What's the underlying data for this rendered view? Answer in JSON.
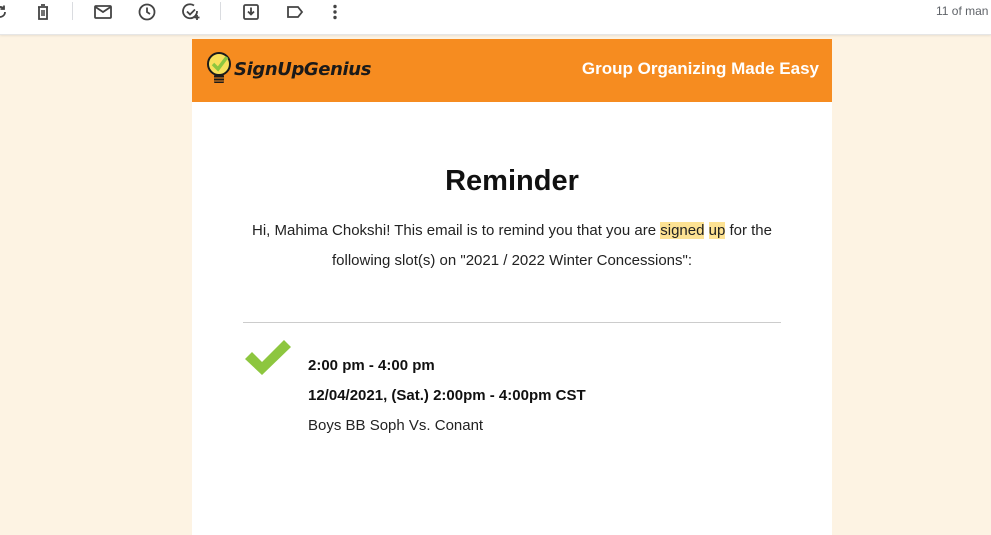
{
  "toolbar": {
    "icons": [
      "refresh-icon",
      "delete-icon",
      "mark-unread-icon",
      "snooze-icon",
      "add-task-icon",
      "move-to-icon",
      "label-icon",
      "more-options-icon"
    ],
    "page_count": "11 of man"
  },
  "email": {
    "brand": {
      "name": "SignUpGenius",
      "tagline": "Group Organizing Made Easy",
      "color": "#f68c20"
    },
    "heading": "Reminder",
    "intro": {
      "part1": "Hi, Mahima Chokshi! This email is to remind you that you are ",
      "highlight1": "signed",
      "space": " ",
      "highlight2": "up",
      "part2": " for the following slot(s) on \"2021 / 2022 Winter Concessions\":"
    },
    "slot": {
      "time": "2:00 pm - 4:00 pm",
      "date_line": "12/04/2021, (Sat.) 2:00pm - 4:00pm CST",
      "description": "Boys BB Soph Vs. Conant"
    },
    "colors": {
      "check": "#8dc63f",
      "highlight": "#fde293"
    }
  }
}
